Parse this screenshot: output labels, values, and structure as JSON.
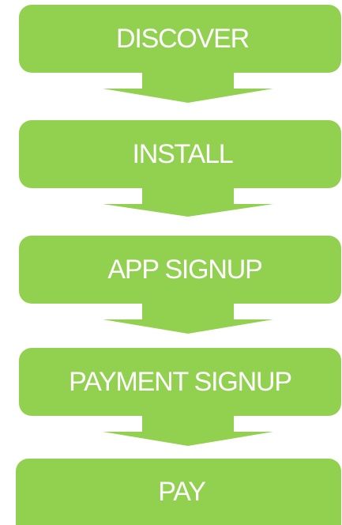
{
  "colors": {
    "accent": "#92d050",
    "text": "#ffffff",
    "background": "#ffffff"
  },
  "steps": [
    {
      "label": "DISCOVER"
    },
    {
      "label": "INSTALL"
    },
    {
      "label": "APP SIGNUP"
    },
    {
      "label": "PAYMENT SIGNUP"
    },
    {
      "label": "PAY"
    }
  ]
}
